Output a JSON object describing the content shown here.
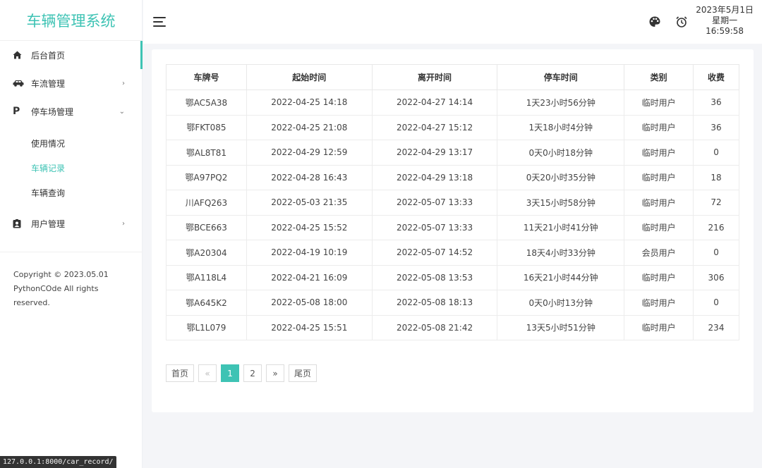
{
  "app": {
    "title": "车辆管理系统",
    "brand_color": "#3ec3b4"
  },
  "sidebar": {
    "items": [
      {
        "label": "后台首页",
        "icon": "home-icon"
      },
      {
        "label": "车流管理",
        "icon": "car-icon",
        "arrow": "›"
      },
      {
        "label": "停车场管理",
        "icon": "parking-icon",
        "arrow": "⌄"
      },
      {
        "label": "用户管理",
        "icon": "user-card-icon",
        "arrow": "›"
      }
    ],
    "parking_sub": [
      "使用情况",
      "车辆记录",
      "车辆查询"
    ],
    "icon_glyphs": {
      "home": "⌂",
      "parking": "P"
    }
  },
  "footer": {
    "copyright": "Copyright © 2023.05.01 PythonCOde All rights reserved."
  },
  "header": {
    "date": "2023年5月1日",
    "weekday": "星期一",
    "time": "16:59:58"
  },
  "table": {
    "headers": [
      "车牌号",
      "起始时间",
      "离开时间",
      "停车时间",
      "类别",
      "收费"
    ],
    "rows": [
      [
        "鄂AC5A38",
        "2022-04-25 14:18",
        "2022-04-27 14:14",
        "1天23小时56分钟",
        "临时用户",
        "36"
      ],
      [
        "鄂FKT085",
        "2022-04-25 21:08",
        "2022-04-27 15:12",
        "1天18小时4分钟",
        "临时用户",
        "36"
      ],
      [
        "鄂AL8T81",
        "2022-04-29 12:59",
        "2022-04-29 13:17",
        "0天0小时18分钟",
        "临时用户",
        "0"
      ],
      [
        "鄂A97PQ2",
        "2022-04-28 16:43",
        "2022-04-29 13:18",
        "0天20小时35分钟",
        "临时用户",
        "18"
      ],
      [
        "川AFQ263",
        "2022-05-03 21:35",
        "2022-05-07 13:33",
        "3天15小时58分钟",
        "临时用户",
        "72"
      ],
      [
        "鄂BCE663",
        "2022-04-25 15:52",
        "2022-05-07 13:33",
        "11天21小时41分钟",
        "临时用户",
        "216"
      ],
      [
        "鄂A20304",
        "2022-04-19 10:19",
        "2022-05-07 14:52",
        "18天4小时33分钟",
        "会员用户",
        "0"
      ],
      [
        "鄂A118L4",
        "2022-04-21 16:09",
        "2022-05-08 13:53",
        "16天21小时44分钟",
        "临时用户",
        "306"
      ],
      [
        "鄂A645K2",
        "2022-05-08 18:00",
        "2022-05-08 18:13",
        "0天0小时13分钟",
        "临时用户",
        "0"
      ],
      [
        "鄂L1L079",
        "2022-04-25 15:51",
        "2022-05-08 21:42",
        "13天5小时51分钟",
        "临时用户",
        "234"
      ]
    ]
  },
  "pagination": {
    "first": "首页",
    "prev": "«",
    "pages": [
      "1",
      "2"
    ],
    "next": "»",
    "last": "尾页",
    "current": "1"
  },
  "status_bar": {
    "url": "127.0.0.1:8000/car_record/"
  }
}
